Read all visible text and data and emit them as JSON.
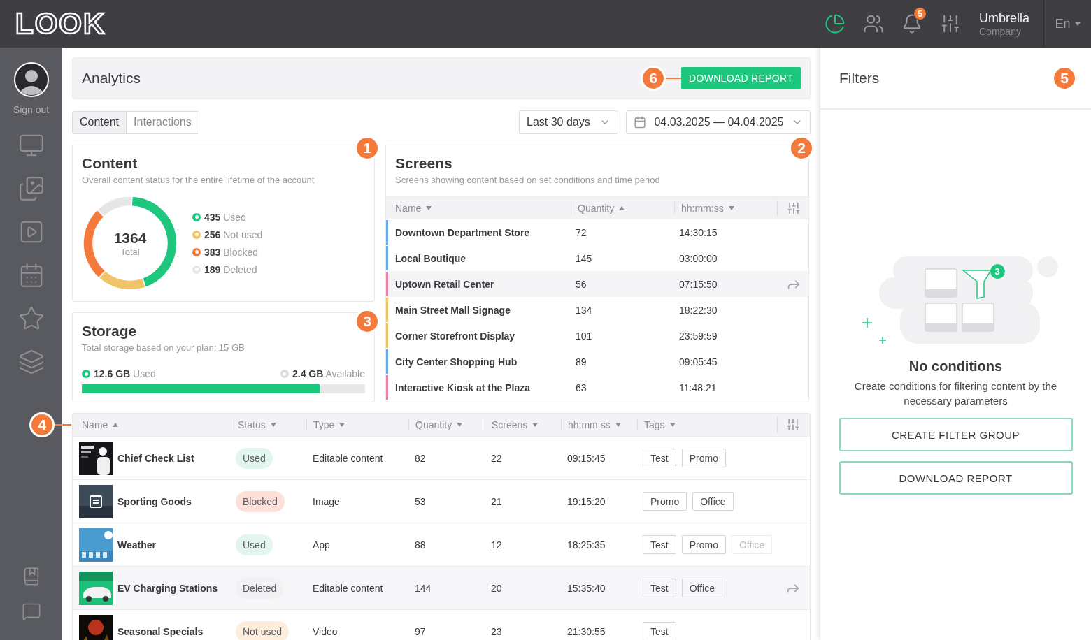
{
  "topbar": {
    "logo": "LOOK",
    "actions": [
      {
        "kind": "analytics",
        "selected": true
      },
      {
        "kind": "users",
        "selected": false
      },
      {
        "kind": "notifications",
        "selected": false,
        "badge": "5"
      },
      {
        "kind": "mixer",
        "selected": false
      }
    ],
    "account": {
      "name": "Umbrella",
      "role": "Company"
    },
    "language": "En"
  },
  "sidebar": {
    "sign_out": "Sign out",
    "items": [
      {
        "kind": "screens"
      },
      {
        "kind": "images"
      },
      {
        "kind": "videos"
      },
      {
        "kind": "schedule"
      },
      {
        "kind": "favorites"
      },
      {
        "kind": "layers"
      }
    ],
    "footer_items": [
      {
        "kind": "docs"
      },
      {
        "kind": "chat"
      }
    ]
  },
  "header": {
    "title": "Analytics",
    "marker": "6",
    "download_button": "DOWNLOAD REPORT"
  },
  "tabs": [
    {
      "label": "Content",
      "selected": true
    },
    {
      "label": "Interactions",
      "selected": false
    }
  ],
  "period": {
    "value": "Last 30 days"
  },
  "date_range": {
    "value": "04.03.2025 — 04.04.2025"
  },
  "content_card": {
    "marker": "1",
    "title": "Content",
    "subtitle": "Overall content status for the entire lifetime of the account",
    "total": "1364",
    "total_label": "Total",
    "legend": [
      {
        "value": "435",
        "label": "Used",
        "color": "#1dc77e"
      },
      {
        "value": "256",
        "label": "Not used",
        "color": "#f0c56a"
      },
      {
        "value": "383",
        "label": "Blocked",
        "color": "#f47a3c"
      },
      {
        "value": "189",
        "label": "Deleted",
        "color": "#e6e6e9"
      }
    ],
    "chart_data": {
      "type": "donut",
      "values": [
        44,
        17,
        26,
        13
      ]
    }
  },
  "storage_card": {
    "marker": "3",
    "title": "Storage",
    "subtitle": "Total storage based on your plan: 15 GB",
    "used_value": "12.6 GB",
    "used_label": "Used",
    "available_value": "2.4 GB",
    "available_label": "Available",
    "level": 0.84
  },
  "screens_card": {
    "marker": "2",
    "title": "Screens",
    "subtitle": "Screens showing content based on set conditions and time period",
    "columns": [
      {
        "label": "Name",
        "ascending": false
      },
      {
        "label": "Quantity",
        "ascending": true
      },
      {
        "label": "hh:mm:ss",
        "ascending": false
      }
    ],
    "rows": [
      {
        "name": "Downtown Department Store",
        "quantity": "72",
        "time": "14:30:15",
        "color": "#6aaaea",
        "hovered": false
      },
      {
        "name": "Local Boutique",
        "quantity": "145",
        "time": "03:00:00",
        "color": "#6aaaea",
        "hovered": false
      },
      {
        "name": "Uptown Retail Center",
        "quantity": "56",
        "time": "07:15:50",
        "color": "#e784a5",
        "hovered": true
      },
      {
        "name": "Main Street Mall Signage",
        "quantity": "134",
        "time": "18:22:30",
        "color": "#f0c56a",
        "hovered": false
      },
      {
        "name": "Corner Storefront Display",
        "quantity": "101",
        "time": "23:59:59",
        "color": "#f0c56a",
        "hovered": false
      },
      {
        "name": "City Center Shopping Hub",
        "quantity": "89",
        "time": "09:05:45",
        "color": "#6aaaea",
        "hovered": false
      },
      {
        "name": "Interactive Kiosk at the Plaza",
        "quantity": "63",
        "time": "11:48:21",
        "color": "#e784a5",
        "hovered": false
      }
    ]
  },
  "content_table": {
    "marker": "4",
    "columns": [
      {
        "label": "Name",
        "ascending": true
      },
      {
        "label": "Status",
        "ascending": false
      },
      {
        "label": "Type",
        "ascending": false
      },
      {
        "label": "Quantity",
        "ascending": false
      },
      {
        "label": "Screens",
        "ascending": false
      },
      {
        "label": "hh:mm:ss",
        "ascending": false
      },
      {
        "label": "Tags",
        "ascending": false
      }
    ],
    "rows": [
      {
        "name": "Chief Check List",
        "status": {
          "label": "Used",
          "color": "#e2f6ee"
        },
        "type": "Editable content",
        "quantity": "82",
        "screens": "22",
        "time": "09:15:45",
        "hovered": false,
        "tags": [
          {
            "label": "Test",
            "faded": false
          },
          {
            "label": "Promo",
            "faded": false
          }
        ]
      },
      {
        "name": "Sporting Goods",
        "status": {
          "label": "Blocked",
          "color": "#fde0d8"
        },
        "type": "Image",
        "quantity": "53",
        "screens": "21",
        "time": "19:15:20",
        "hovered": false,
        "tags": [
          {
            "label": "Promo",
            "faded": false
          },
          {
            "label": "Office",
            "faded": false
          }
        ]
      },
      {
        "name": "Weather",
        "status": {
          "label": "Used",
          "color": "#e2f6ee"
        },
        "type": "App",
        "quantity": "88",
        "screens": "12",
        "time": "18:25:35",
        "hovered": false,
        "tags": [
          {
            "label": "Test",
            "faded": false
          },
          {
            "label": "Promo",
            "faded": false
          },
          {
            "label": "Office",
            "faded": true
          }
        ]
      },
      {
        "name": "EV Charging Stations",
        "status": {
          "label": "Deleted",
          "color": "#f1f1f3"
        },
        "type": "Editable content",
        "quantity": "144",
        "screens": "20",
        "time": "15:35:40",
        "hovered": true,
        "tags": [
          {
            "label": "Test",
            "faded": false
          },
          {
            "label": "Office",
            "faded": false
          }
        ]
      },
      {
        "name": "Seasonal Specials",
        "status": {
          "label": "Not used",
          "color": "#fdeedc"
        },
        "type": "Video",
        "quantity": "97",
        "screens": "23",
        "time": "21:30:55",
        "hovered": false,
        "tags": [
          {
            "label": "Test",
            "faded": false
          }
        ]
      }
    ]
  },
  "filters": {
    "title": "Filters",
    "marker": "5",
    "badge": "3",
    "empty_title": "No conditions",
    "empty_text": "Create conditions for filtering content by the necessary parameters",
    "buttons": [
      "CREATE FILTER GROUP",
      "DOWNLOAD REPORT"
    ]
  }
}
